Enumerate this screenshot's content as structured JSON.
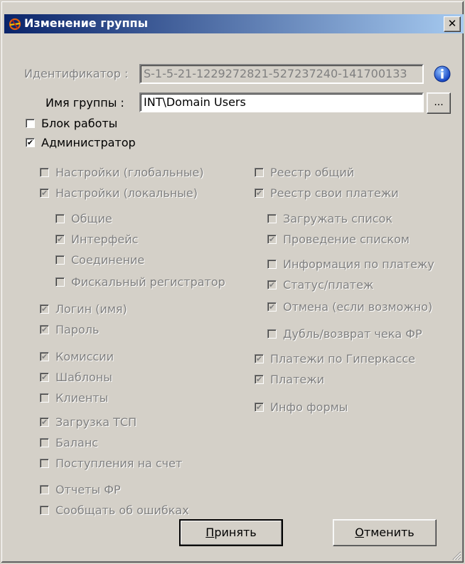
{
  "window": {
    "title": "Изменение группы",
    "close_label": "✕"
  },
  "form": {
    "identifier_label": "Идентификатор :",
    "identifier_value": "S-1-5-21-1229272821-527237240-141700133",
    "group_name_label": "Имя группы :",
    "group_name_value": "INT\\Domain Users",
    "browse_label": "..."
  },
  "top_checks": [
    {
      "label": "Блок работы",
      "checked": false
    },
    {
      "label": "Администратор",
      "checked": true
    }
  ],
  "left_col": [
    {
      "label": "Настройки (глобальные)",
      "checked": false
    },
    {
      "label": "Настройки (локальные)",
      "checked": true
    },
    {
      "label": "Общие",
      "checked": false
    },
    {
      "label": "Интерфейс",
      "checked": true
    },
    {
      "label": "Соединение",
      "checked": false
    },
    {
      "label": "Фискальный регистратор",
      "checked": false
    },
    {
      "label": "Логин (имя)",
      "checked": true
    },
    {
      "label": "Пароль",
      "checked": true
    },
    {
      "label": "Комиссии",
      "checked": true
    },
    {
      "label": "Шаблоны",
      "checked": true
    },
    {
      "label": "Клиенты",
      "checked": false
    },
    {
      "label": "Загрузка ТСП",
      "checked": true
    },
    {
      "label": "Баланс",
      "checked": false
    },
    {
      "label": "Поступления на счет",
      "checked": false
    },
    {
      "label": "Отчеты ФР",
      "checked": false
    },
    {
      "label": "Сообщать об ошибках",
      "checked": false
    }
  ],
  "right_col": [
    {
      "label": "Реестр общий",
      "checked": false
    },
    {
      "label": "Реестр свои платежи",
      "checked": true
    },
    {
      "label": "Загружать список",
      "checked": false
    },
    {
      "label": "Проведение списком",
      "checked": true
    },
    {
      "label": "Информация по платежу",
      "checked": false
    },
    {
      "label": "Статус/платеж",
      "checked": true
    },
    {
      "label": "Отмена (если возможно)",
      "checked": true
    },
    {
      "label": "Дубль/возврат чека ФР",
      "checked": false
    },
    {
      "label": "Платежи по Гиперкассе",
      "checked": true
    },
    {
      "label": "Платежи",
      "checked": true
    },
    {
      "label": "Инфо формы",
      "checked": true
    }
  ],
  "buttons": {
    "accept_first": "П",
    "accept_rest": "ринять",
    "cancel_first": "О",
    "cancel_rest": "тменить"
  },
  "colors": {
    "dialog_bg": "#d4d0c8",
    "title_gradient_start": "#0a246a",
    "title_gradient_end": "#a6caf0",
    "disabled_text": "#808080"
  },
  "icons": [
    "app-icon",
    "close-icon",
    "info-icon",
    "resize-grip-icon"
  ]
}
